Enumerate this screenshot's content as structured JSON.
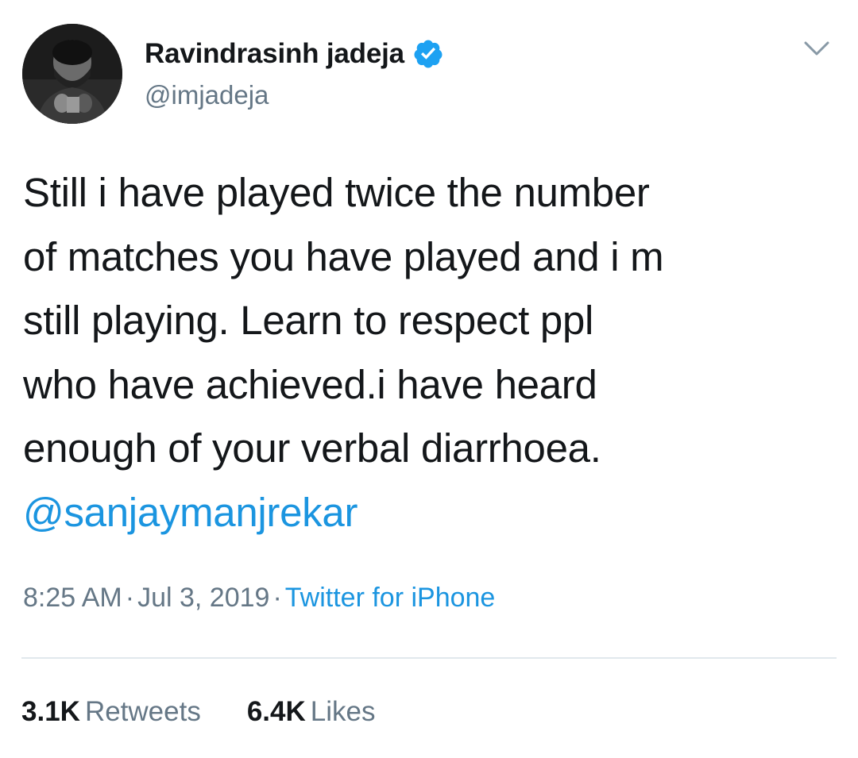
{
  "author": {
    "display_name": "Ravindrasinh jadeja",
    "handle": "@imjadeja",
    "verified": true,
    "avatar_icon": "profile-photo"
  },
  "tweet": {
    "lines": [
      "Still i have played twice the number",
      "of matches you have played and i m",
      "still playing. Learn to respect ppl",
      "who have achieved.i have heard",
      "enough of your verbal diarrhoea."
    ],
    "mention": "@sanjaymanjrekar"
  },
  "meta": {
    "time": "8:25 AM",
    "separator": "·",
    "date": "Jul 3, 2019",
    "source": "Twitter for iPhone"
  },
  "stats": {
    "retweets_count": "3.1K",
    "retweets_label": "Retweets",
    "likes_count": "6.4K",
    "likes_label": "Likes"
  },
  "colors": {
    "text": "#14171a",
    "secondary": "#657786",
    "link": "#1b95e0",
    "divider": "#e1e8ed",
    "verified_badge": "#1da1f2"
  },
  "icons": {
    "verified": "verified-badge-icon",
    "menu": "chevron-down-icon"
  }
}
